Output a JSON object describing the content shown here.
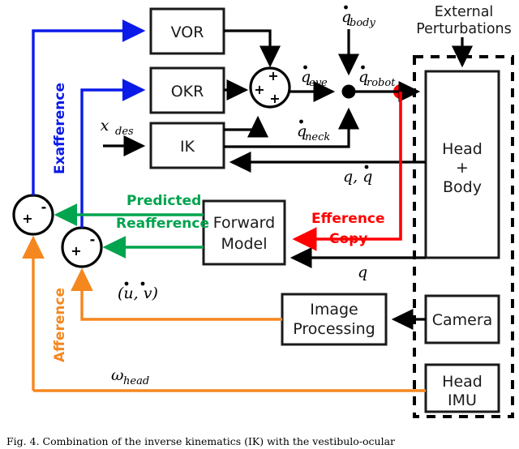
{
  "figure": {
    "title": "Sensorimotor control block diagram: IK with VOR and OKR",
    "caption": "Fig. 4.   Combination of the inverse kinematics (IK) with the vestibulo-ocular"
  },
  "blocks": {
    "vor": "VOR",
    "okr": "OKR",
    "ik": "IK",
    "head_body_line1": "Head",
    "head_body_line2": "+",
    "head_body_line3": "Body",
    "forward_model_line1": "Forward",
    "forward_model_line2": "Model",
    "image_processing_line1": "Image",
    "image_processing_line2": "Processing",
    "camera": "Camera",
    "head_imu_line1": "Head",
    "head_imu_line2": "IMU"
  },
  "signals": {
    "x_des": "x",
    "x_des_sub": "des",
    "q_body": "q",
    "q_body_sub": "body",
    "q_eye": "q",
    "q_eye_sub": "eye",
    "q_robot": "q",
    "q_robot_sub": "robot",
    "q_neck": "q",
    "q_neck_sub": "neck",
    "q_and_qdot": "q, q",
    "q_single": "q",
    "uv_dot": "(u, v)",
    "omega_head": "ω",
    "omega_head_sub": "head"
  },
  "annotations": {
    "external_perturbations_line1": "External",
    "external_perturbations_line2": "Perturbations",
    "exafference": "Exafference",
    "afference": "Afference",
    "predicted": "Predicted",
    "reafference": "Reafference",
    "efference": "Efference",
    "copy": "Copy"
  },
  "sum_junctions": [
    {
      "name": "eye-velocity-sum",
      "plus_count": 3,
      "minus_count": 0
    },
    {
      "name": "exafference-sum",
      "plus": "+",
      "minus": "-"
    },
    {
      "name": "afference-sum",
      "plus": "+",
      "minus": "-"
    }
  ],
  "colors": {
    "blue": "#0a1ae8",
    "green": "#00a44e",
    "orange": "#f5871f",
    "red": "#ff0000",
    "black": "#000000",
    "box_stroke": "#1a1a1a",
    "background": "#ffffff"
  }
}
